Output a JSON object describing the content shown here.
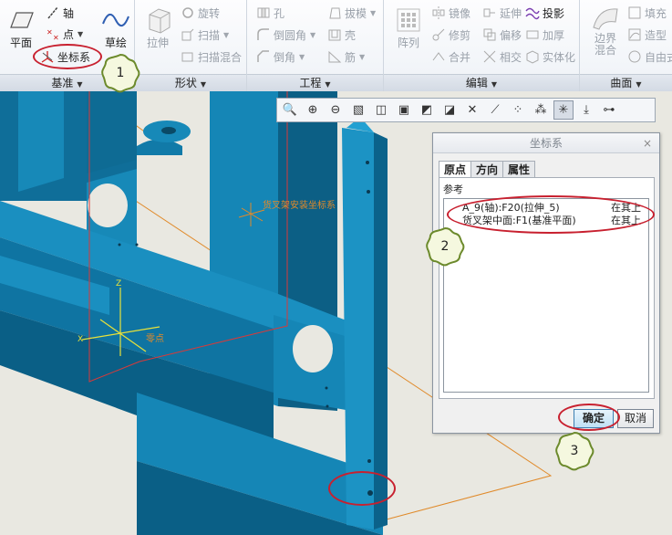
{
  "ribbon": {
    "datum": {
      "label": "基准",
      "plane": "平面",
      "axis": "轴",
      "point": "点",
      "csys": "坐标系",
      "sketch": "草绘"
    },
    "shapes": {
      "label": "形状",
      "extrude": "拉伸",
      "revolve": "旋转",
      "sweep": "扫描",
      "swept_blend": "扫描混合"
    },
    "engineering": {
      "label": "工程",
      "hole": "孔",
      "round": "倒圆角",
      "chamfer": "倒角",
      "draft": "拔模",
      "shell": "壳",
      "rib": "筋"
    },
    "editing": {
      "label": "编辑",
      "pattern": "阵列",
      "mirror": "镜像",
      "trim": "修剪",
      "merge": "合并",
      "extend": "延伸",
      "offset": "偏移",
      "intersect": "相交",
      "project": "投影",
      "thicken": "加厚",
      "solidify": "实体化"
    },
    "surfaces": {
      "label": "曲面",
      "boundary_blend": "边界混合",
      "fill": "填充",
      "style": "造型",
      "freestyle": "自由式"
    }
  },
  "viewport": {
    "csys_label": "货叉架安装坐标系",
    "origin_label": "零点",
    "axis_z": "Z",
    "axis_x": "X"
  },
  "dialog": {
    "title": "坐标系",
    "close": "×",
    "tabs": [
      "原点",
      "方向",
      "属性"
    ],
    "section_label": "参考",
    "references": [
      {
        "item": "A_9(轴):F20(拉伸_5)",
        "constraint": "在其上"
      },
      {
        "item": "货叉架中面:F1(基准平面)",
        "constraint": "在其上"
      }
    ],
    "ok_label": "确定",
    "cancel_label": "取消"
  },
  "callouts": [
    "1",
    "2",
    "3"
  ],
  "colors": {
    "model": "#1f8fbf",
    "model_dark": "#0d5f84",
    "callout_ring": "#c8202f",
    "badge_fill": "#f5f8df",
    "badge_stroke": "#6c8a2c",
    "datum_orange": "#e08a2a",
    "datum_red": "#d83a3a"
  }
}
